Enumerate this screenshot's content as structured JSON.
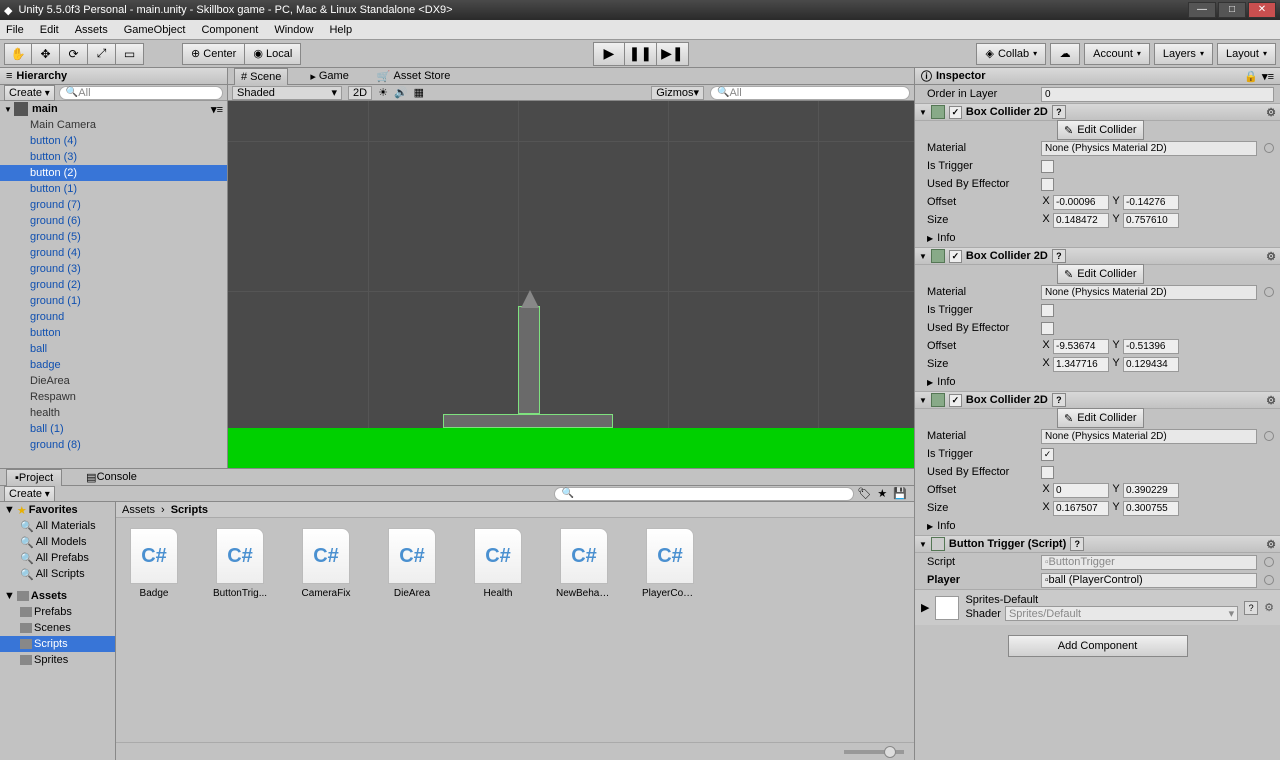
{
  "title": "Unity 5.5.0f3 Personal - main.unity - Skillbox game - PC, Mac & Linux Standalone <DX9>",
  "menu": [
    "File",
    "Edit",
    "Assets",
    "GameObject",
    "Component",
    "Window",
    "Help"
  ],
  "toolbar": {
    "center": "Center",
    "local": "Local",
    "collab": "Collab",
    "account": "Account",
    "layers": "Layers",
    "layout": "Layout"
  },
  "hierarchy": {
    "title": "Hierarchy",
    "create": "Create",
    "search": "All",
    "scene": "main",
    "items": [
      {
        "name": "Main Camera",
        "dark": true
      },
      {
        "name": "button (4)"
      },
      {
        "name": "button (3)"
      },
      {
        "name": "button (2)",
        "selected": true
      },
      {
        "name": "button (1)"
      },
      {
        "name": "ground (7)"
      },
      {
        "name": "ground (6)"
      },
      {
        "name": "ground (5)"
      },
      {
        "name": "ground (4)"
      },
      {
        "name": "ground (3)"
      },
      {
        "name": "ground (2)"
      },
      {
        "name": "ground (1)"
      },
      {
        "name": "ground"
      },
      {
        "name": "button"
      },
      {
        "name": "ball"
      },
      {
        "name": "badge"
      },
      {
        "name": "DieArea",
        "dark": true
      },
      {
        "name": "Respawn",
        "dark": true
      },
      {
        "name": "health",
        "dark": true
      },
      {
        "name": "ball (1)"
      },
      {
        "name": "ground (8)"
      }
    ]
  },
  "sceneTabs": {
    "scene": "Scene",
    "game": "Game",
    "asset": "Asset Store"
  },
  "sceneToolbar": {
    "shaded": "Shaded",
    "mode": "2D",
    "gizmos": "Gizmos",
    "search": "All"
  },
  "project": {
    "title": "Project",
    "console": "Console",
    "create": "Create",
    "favorites": "Favorites",
    "favs": [
      "All Materials",
      "All Models",
      "All Prefabs",
      "All Scripts"
    ],
    "assets": "Assets",
    "folders": [
      "Prefabs",
      "Scenes",
      "Scripts",
      "Sprites"
    ],
    "breadcrumb": [
      "Assets",
      "Scripts"
    ],
    "files": [
      "Badge",
      "ButtonTrig...",
      "CameraFix",
      "DieArea",
      "Health",
      "NewBehavi...",
      "PlayerCont..."
    ]
  },
  "inspector": {
    "title": "Inspector",
    "orderLabel": "Order in Layer",
    "orderValue": "0",
    "boxCollider": "Box Collider 2D",
    "editCollider": "Edit Collider",
    "material": "Material",
    "materialValue": "None (Physics Material 2D)",
    "isTrigger": "Is Trigger",
    "usedByEffector": "Used By Effector",
    "offset": "Offset",
    "size": "Size",
    "info": "Info",
    "c1": {
      "ox": "-0.00096",
      "oy": "-0.14276",
      "sx": "0.148472",
      "sy": "0.757610"
    },
    "c2": {
      "ox": "-9.53674",
      "oy": "-0.51396",
      "sx": "1.347716",
      "sy": "0.129434"
    },
    "c3": {
      "trigger": true,
      "ox": "0",
      "oy": "0.390229",
      "sx": "0.167507",
      "sy": "0.300755"
    },
    "script": {
      "title": "Button Trigger (Script)",
      "scriptLabel": "Script",
      "scriptValue": "ButtonTrigger",
      "player": "Player",
      "playerValue": "ball (PlayerControl)"
    },
    "mat": {
      "name": "Sprites-Default",
      "shader": "Shader",
      "shaderValue": "Sprites/Default"
    },
    "addComponent": "Add Component"
  }
}
